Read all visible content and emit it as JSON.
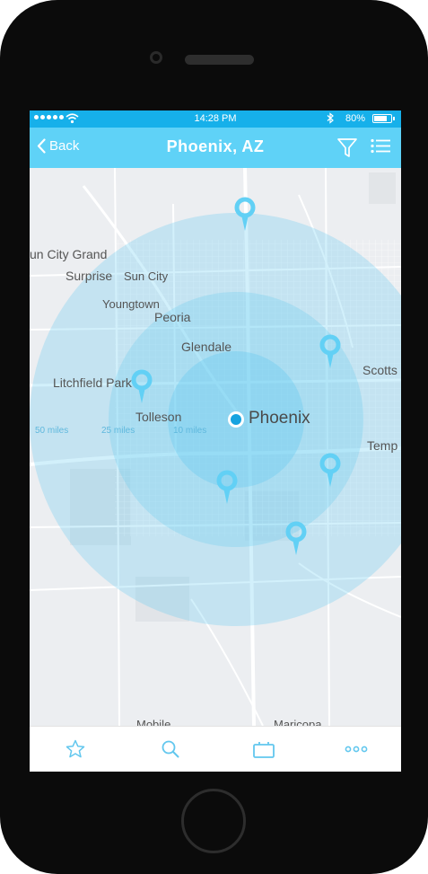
{
  "status_bar": {
    "time": "14:28 PM",
    "battery": "80%",
    "battery_level": 0.8
  },
  "nav": {
    "back_label": "Back",
    "title": "Phoenix, AZ"
  },
  "map": {
    "places": {
      "sun_city_grand": "un City Grand",
      "surprise": "Surprise",
      "sun_city": "Sun City",
      "youngtown": "Youngtown",
      "peoria": "Peoria",
      "glendale": "Glendale",
      "litchfield_park": "Litchfield Park",
      "tolleson": "Tolleson",
      "phoenix": "Phoenix",
      "scottsdale": "Scotts",
      "tempe": "Temp",
      "mobile": "Mobile",
      "maricopa": "Maricopa"
    },
    "rings": {
      "outer": "50 miles",
      "middle": "25 miles",
      "inner": "10 miles"
    },
    "colors": {
      "ring_fill": "#5cc8f0",
      "pin": "#62d0f5",
      "center_dot": "#16a3e0"
    }
  },
  "tabs": {
    "favorites": "star-icon",
    "search": "search-icon",
    "device": "device-icon",
    "more": "more-icon"
  }
}
